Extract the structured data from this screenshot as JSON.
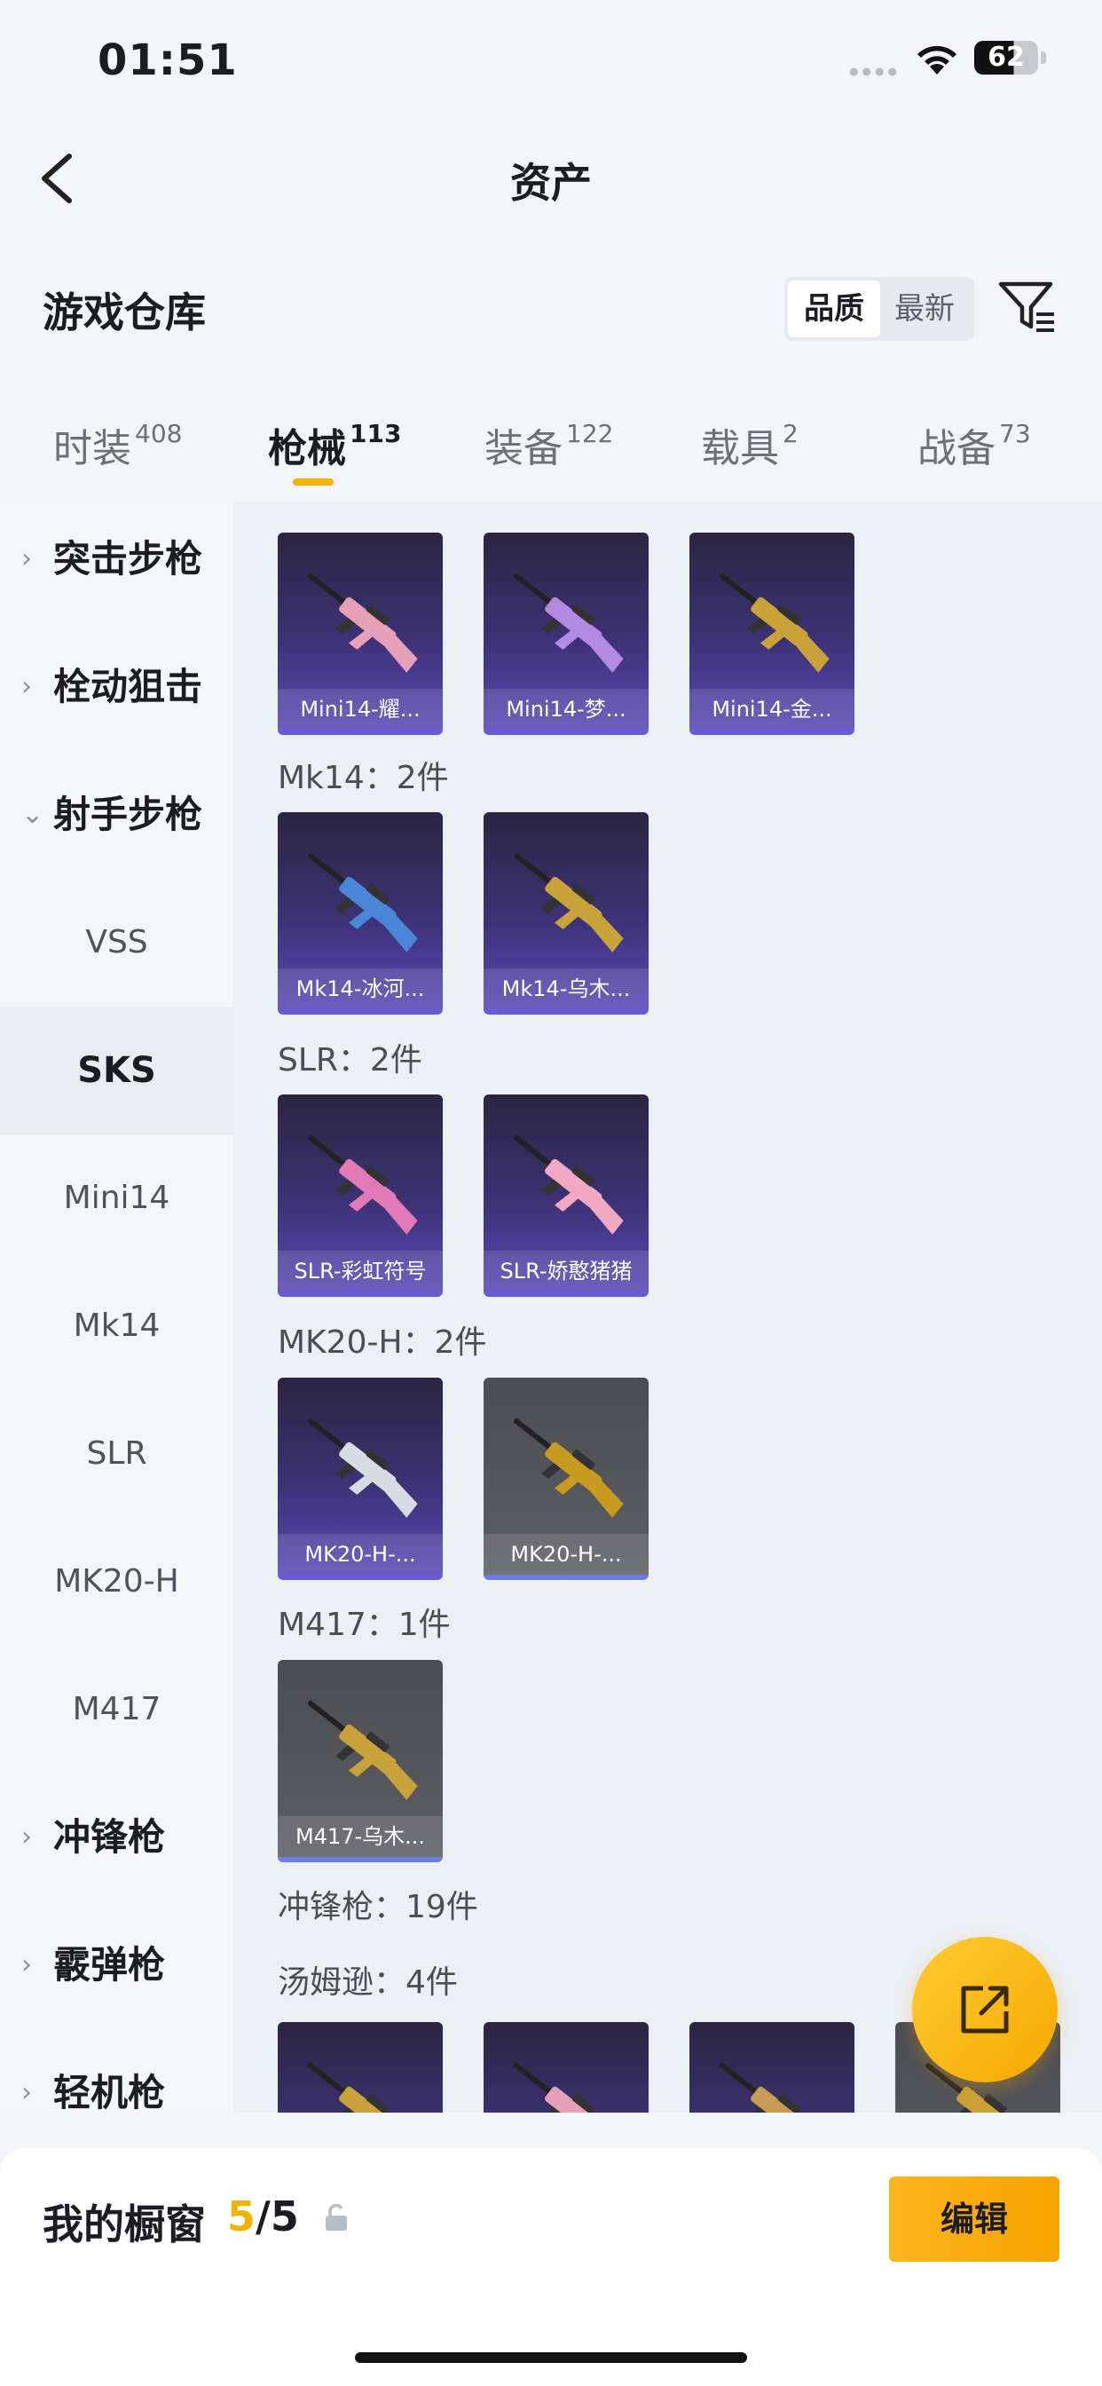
{
  "status": {
    "time": "01:51",
    "battery": "62"
  },
  "nav": {
    "title": "资产"
  },
  "warehouse": {
    "title": "游戏仓库",
    "sort_options": [
      "品质",
      "最新"
    ],
    "sort_selected": "品质"
  },
  "tabs": [
    {
      "label": "时装",
      "count": "408"
    },
    {
      "label": "枪械",
      "count": "113"
    },
    {
      "label": "装备",
      "count": "122"
    },
    {
      "label": "载具",
      "count": "2"
    },
    {
      "label": "战备",
      "count": "73"
    }
  ],
  "active_tab": "枪械",
  "sidebar": {
    "items": [
      {
        "label": "突击步枪",
        "type": "category",
        "expanded": false
      },
      {
        "label": "栓动狙击",
        "type": "category",
        "expanded": false
      },
      {
        "label": "射手步枪",
        "type": "category",
        "expanded": true
      },
      {
        "label": "VSS",
        "type": "sub"
      },
      {
        "label": "SKS",
        "type": "sub",
        "active": true
      },
      {
        "label": "Mini14",
        "type": "sub"
      },
      {
        "label": "Mk14",
        "type": "sub"
      },
      {
        "label": "SLR",
        "type": "sub"
      },
      {
        "label": "MK20-H",
        "type": "sub"
      },
      {
        "label": "M417",
        "type": "sub"
      },
      {
        "label": "冲锋枪",
        "type": "category",
        "expanded": false
      },
      {
        "label": "霰弹枪",
        "type": "category",
        "expanded": false
      },
      {
        "label": "轻机枪",
        "type": "category",
        "expanded": false
      }
    ]
  },
  "groups": [
    {
      "title": "Mk14：2件",
      "items": [
        {
          "label": "Mk14-冰河...",
          "color": "#4a86d8",
          "rarity": "purple"
        },
        {
          "label": "Mk14-乌木...",
          "color": "#c9a23a",
          "rarity": "purple"
        }
      ]
    },
    {
      "title": "SLR：2件",
      "items": [
        {
          "label": "SLR-彩虹符号",
          "color": "#e27ab8",
          "rarity": "purple"
        },
        {
          "label": "SLR-娇憨猪猪",
          "color": "#f0a9c0",
          "rarity": "purple"
        }
      ]
    },
    {
      "title": "MK20-H：2件",
      "items": [
        {
          "label": "MK20-H-...",
          "color": "#d8dbe2",
          "rarity": "purple"
        },
        {
          "label": "MK20-H-...",
          "color": "#c99a20",
          "rarity": "grey"
        }
      ]
    },
    {
      "title": "M417：1件",
      "items": [
        {
          "label": "M417-乌木...",
          "color": "#c9a23a",
          "rarity": "grey"
        }
      ]
    },
    {
      "title": "冲锋枪：19件",
      "items": []
    },
    {
      "title": "汤姆逊：4件",
      "items": [
        {
          "label": "",
          "color": "#c9a23a",
          "rarity": "purple"
        },
        {
          "label": "",
          "color": "#e6a0b8",
          "rarity": "purple"
        },
        {
          "label": "",
          "color": "#c79a55",
          "rarity": "purple"
        },
        {
          "label": "",
          "color": "#c9a23a",
          "rarity": "grey"
        }
      ]
    }
  ],
  "partial_group": {
    "items": [
      {
        "label": "Mini14-耀...",
        "color": "#e6a0b8",
        "rarity": "purple"
      },
      {
        "label": "Mini14-梦...",
        "color": "#b48ae0",
        "rarity": "purple"
      },
      {
        "label": "Mini14-金...",
        "color": "#c9a23a",
        "rarity": "purple"
      }
    ]
  },
  "showcase": {
    "label": "我的橱窗",
    "current": "5",
    "total": "/5"
  },
  "edit_label": "编辑"
}
